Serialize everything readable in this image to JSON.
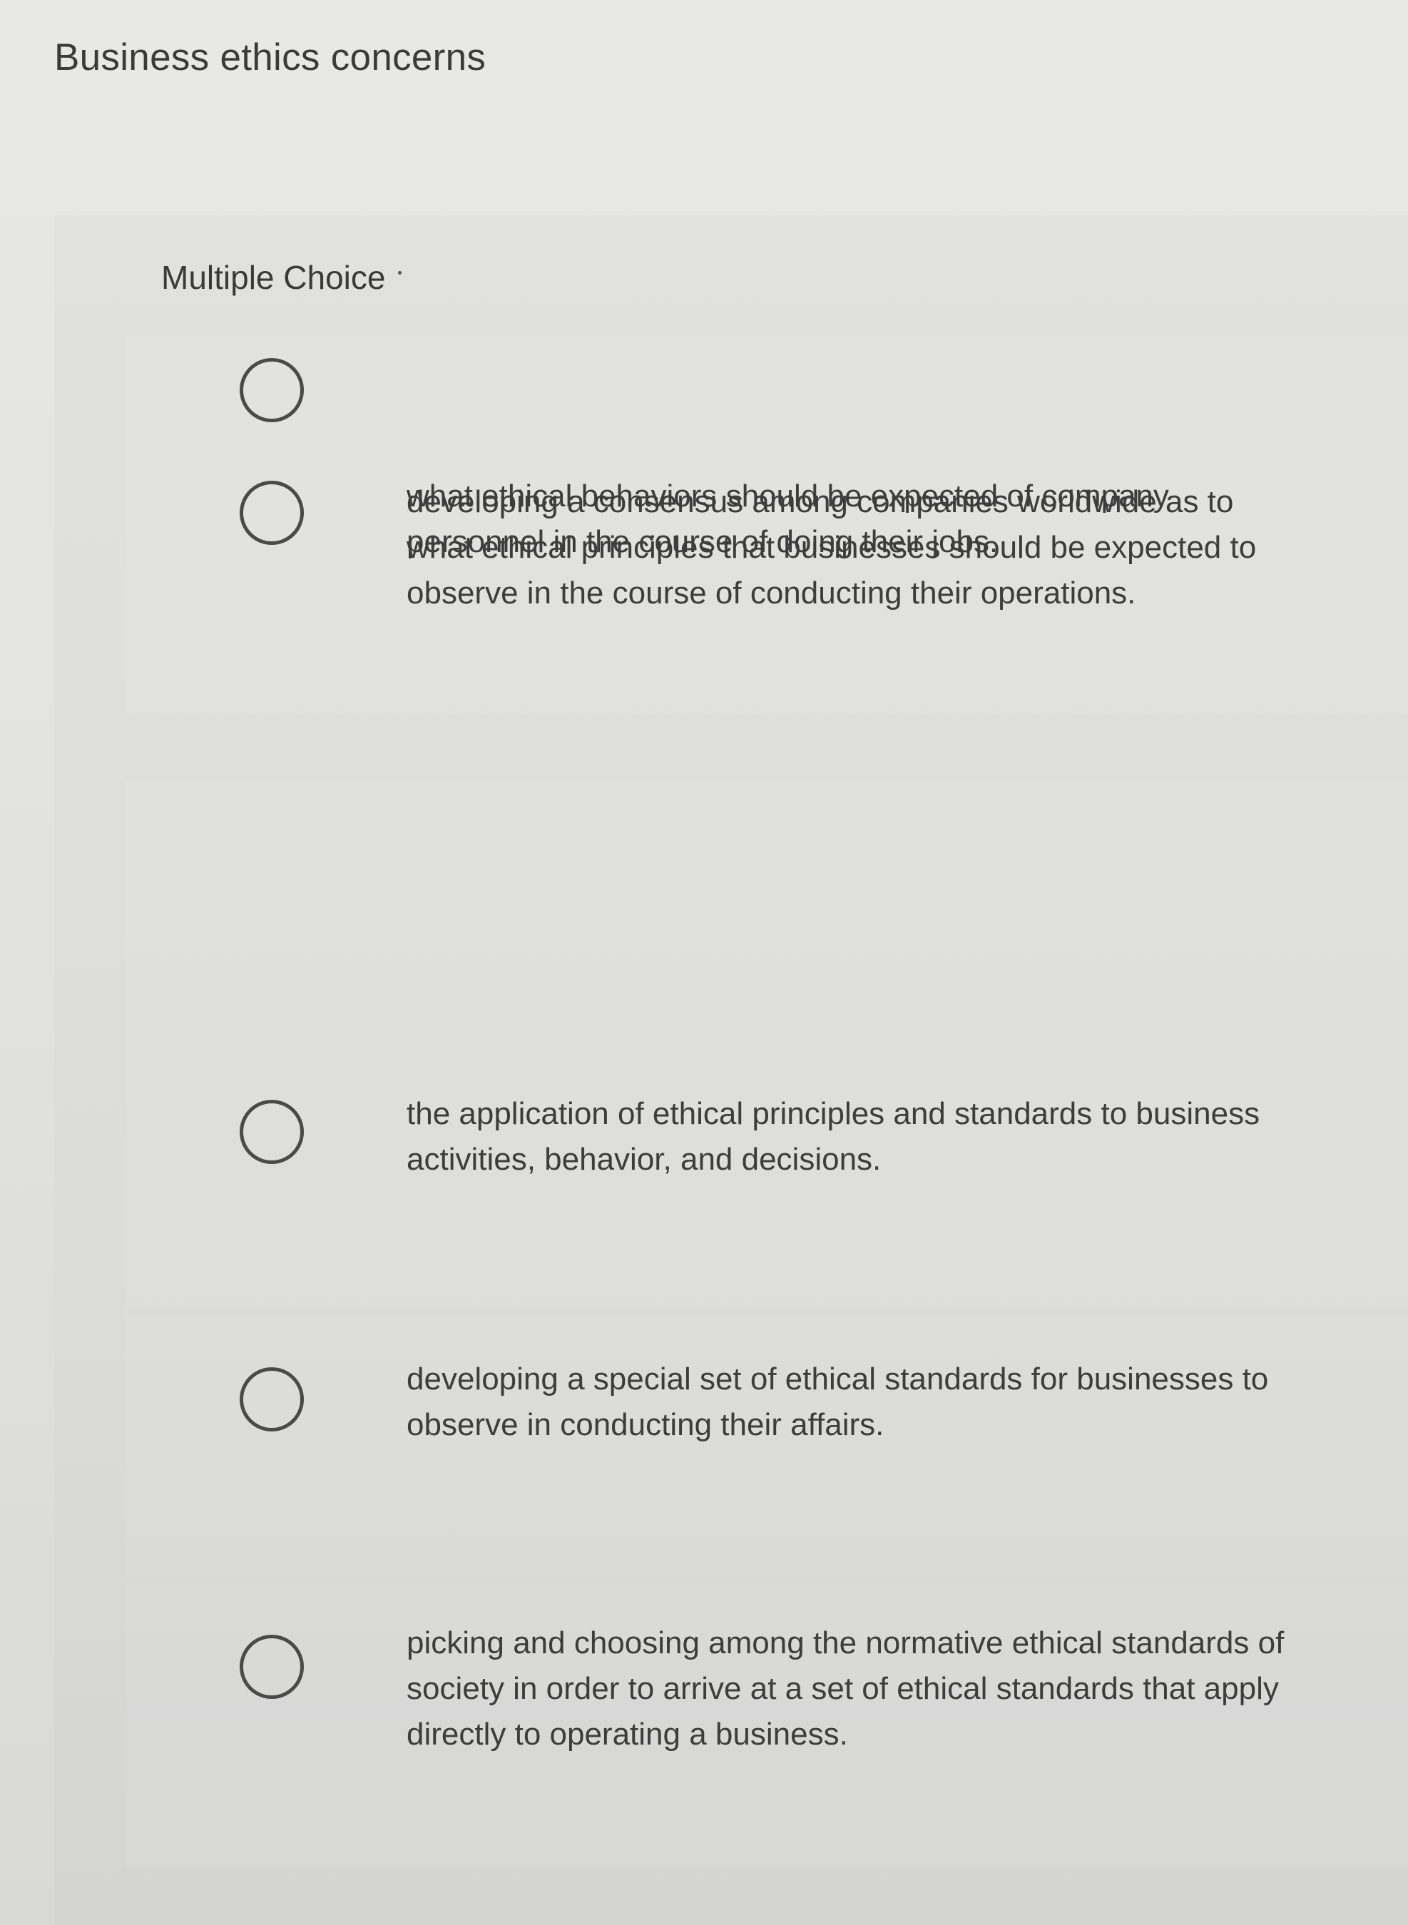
{
  "question": {
    "text": "Business ethics concerns"
  },
  "question_type": "Multiple Choice",
  "options": [
    {
      "text": "developing a consensus among companies worldwide as to what ethical principles that businesses should be expected to observe in the course of conducting their operations.",
      "selected": false
    },
    {
      "text": "what ethical behaviors should be expected of company personnel in the course of doing their jobs.",
      "selected": false
    },
    {
      "text": "the application of ethical principles and standards to business activities, behavior, and decisions.",
      "selected": false
    },
    {
      "text": "developing a special set of ethical standards for businesses to observe in conducting their affairs.",
      "selected": false
    },
    {
      "text": "picking and choosing among the normative ethical standards of society in order to arrive at a set of ethical standards that apply directly to operating a business.",
      "selected": false
    }
  ]
}
